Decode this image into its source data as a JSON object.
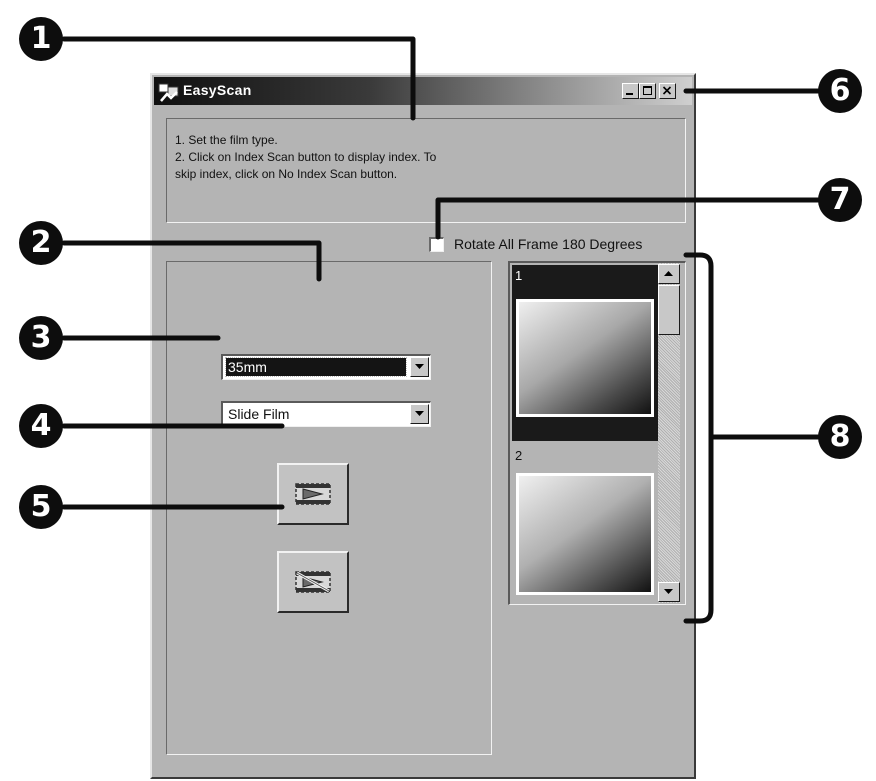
{
  "window": {
    "title": "EasyScan",
    "controls": {
      "minimize_icon": "minimize-icon",
      "maximize_icon": "maximize-icon",
      "close_icon": "close-icon"
    }
  },
  "instructions": {
    "line1": "1. Set the film type.",
    "line2": "2. Click on Index Scan button to display index. To",
    "line3": "skip index, click on No Index Scan button."
  },
  "rotate_option": {
    "label": "Rotate All Frame 180 Degrees",
    "checked": false
  },
  "film_size": {
    "selected": "35mm"
  },
  "film_type": {
    "selected": "Slide Film"
  },
  "buttons": {
    "index_scan_icon": "index-scan-icon",
    "no_index_scan_icon": "no-index-scan-icon"
  },
  "thumbnails": [
    {
      "label": "1",
      "selected": true
    },
    {
      "label": "2",
      "selected": false
    }
  ],
  "callouts": [
    "1",
    "2",
    "3",
    "4",
    "5",
    "6",
    "7",
    "8"
  ],
  "colors": {
    "titlebar_dark": "#101010",
    "titlebar_light": "#cfcfcf",
    "window_face": "#b4b4b4",
    "callout": "#0d0d0d"
  }
}
